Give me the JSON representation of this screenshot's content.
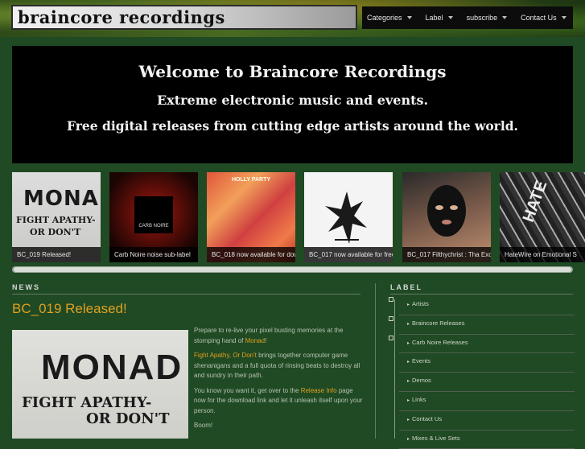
{
  "site": {
    "logo": "braincore recordings"
  },
  "nav": {
    "items": [
      {
        "label": "Categories"
      },
      {
        "label": "Label"
      },
      {
        "label": "subscribe"
      },
      {
        "label": "Contact Us"
      }
    ]
  },
  "banner": {
    "line1": "Welcome to Braincore Recordings",
    "line2": "Extreme electronic music and events.",
    "line3": "Free digital releases from cutting edge artists around the world."
  },
  "carousel": {
    "slides": [
      {
        "caption": "BC_019 Released!",
        "art_line1": "MONAD",
        "art_line2": "FIGHT APATHY-",
        "art_line3": "OR DON'T"
      },
      {
        "caption": "Carb Noire noise sub-label",
        "art_text": "CARB NOIRE"
      },
      {
        "caption": "BC_018 now available for dow",
        "art_text": "HOLLY PARTY"
      },
      {
        "caption": "BC_017 now available for free"
      },
      {
        "caption": "BC_017 Filthychrist : Tha Exo"
      },
      {
        "caption": "HateWire on Emotional S",
        "art_text": "HATE"
      }
    ]
  },
  "news": {
    "heading": "NEWS",
    "post_title": "BC_019 Released!",
    "image": {
      "line1": "MONAD",
      "line2": "FIGHT APATHY-",
      "line3": "OR DON'T"
    },
    "p1_text": "Prepare to re-live your pixel busting memories at the stomping hand of ",
    "p1_link": "Monad",
    "p1_end": "!",
    "p2_link": "Fight Apathy, Or Don't",
    "p2_text": " brings together computer game shenanigans and a full quota of rinsing beats to destroy all and sundry in their path.",
    "p3_text": "You know you want it, get over to the ",
    "p3_link": "Release Info",
    "p3_end": " page now for the download link and let it unleash itself upon your person.",
    "p4_text": "Boom!"
  },
  "label": {
    "heading": "LABEL",
    "items": [
      {
        "label": "Artists",
        "expandable": true
      },
      {
        "label": "Braincore Releases",
        "expandable": true
      },
      {
        "label": "Carb Noire Releases",
        "expandable": true
      },
      {
        "label": "Events",
        "expandable": false
      },
      {
        "label": "Demos",
        "expandable": false
      },
      {
        "label": "Links",
        "expandable": false
      },
      {
        "label": "Contact Us",
        "expandable": false
      },
      {
        "label": "Mixes & Live Sets",
        "expandable": false
      }
    ]
  },
  "colors": {
    "background": "#1f4a24",
    "accent": "#e0a020",
    "nav_bg": "#0c0c0c"
  }
}
